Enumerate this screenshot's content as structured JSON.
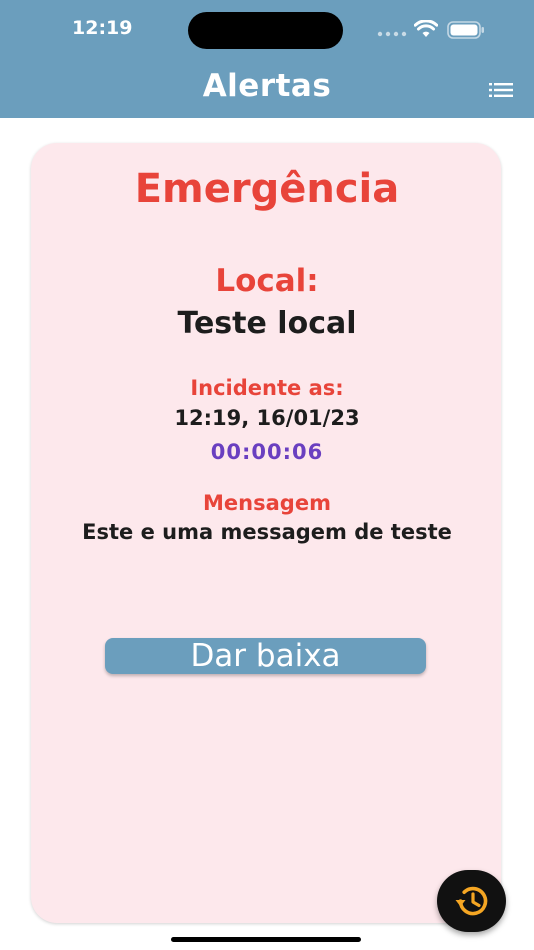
{
  "status_bar": {
    "time": "12:19"
  },
  "header": {
    "title": "Alertas",
    "menu_icon": "list-icon",
    "background_color": "#6b9ebd"
  },
  "alert_card": {
    "title": "Emergência",
    "local_label": "Local:",
    "local_value": "Teste local",
    "incident_label": "Incidente as:",
    "incident_time": "12:19, 16/01/23",
    "elapsed": "00:00:06",
    "message_label": "Mensagem",
    "message_text": "Este e uma messagem de teste",
    "dismiss_label": "Dar baixa",
    "background_color": "#fde8ec",
    "accent_color": "#e8443a",
    "timer_color": "#6a3fc0"
  },
  "fab": {
    "icon": "history-icon",
    "icon_color": "#f5a623"
  }
}
